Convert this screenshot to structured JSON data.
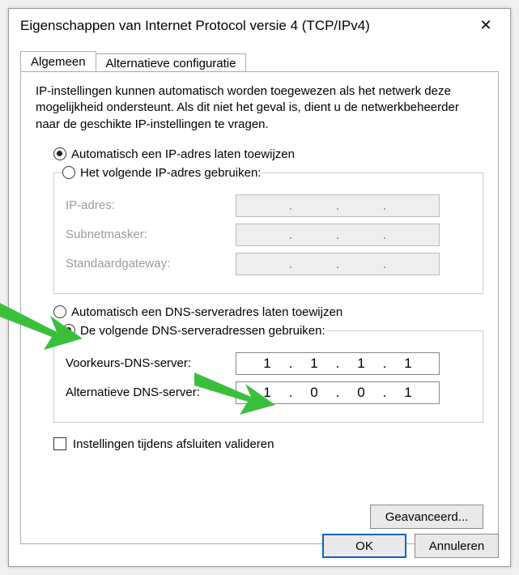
{
  "window": {
    "title": "Eigenschappen van Internet Protocol versie 4 (TCP/IPv4)"
  },
  "tabs": {
    "general": "Algemeen",
    "alternate": "Alternatieve configuratie"
  },
  "info": "IP-instellingen kunnen automatisch worden toegewezen als het netwerk deze mogelijkheid ondersteunt. Als dit niet het geval is, dient u de netwerkbeheerder naar de geschikte IP-instellingen te vragen.",
  "ip": {
    "auto_label": "Automatisch een IP-adres laten toewijzen",
    "manual_label": "Het volgende IP-adres gebruiken:",
    "address_label": "IP-adres:",
    "subnet_label": "Subnetmasker:",
    "gateway_label": "Standaardgateway:",
    "selected": "auto"
  },
  "dns": {
    "auto_label": "Automatisch een DNS-serveradres laten toewijzen",
    "manual_label": "De volgende DNS-serveradressen gebruiken:",
    "preferred_label": "Voorkeurs-DNS-server:",
    "alternate_label": "Alternatieve DNS-server:",
    "selected": "manual",
    "preferred": {
      "o1": "1",
      "o2": "1",
      "o3": "1",
      "o4": "1"
    },
    "alternate": {
      "o1": "1",
      "o2": "0",
      "o3": "0",
      "o4": "1"
    }
  },
  "validate_label": "Instellingen tijdens afsluiten valideren",
  "validate_checked": false,
  "advanced_label": "Geavanceerd...",
  "ok_label": "OK",
  "cancel_label": "Annuleren",
  "dot": "."
}
